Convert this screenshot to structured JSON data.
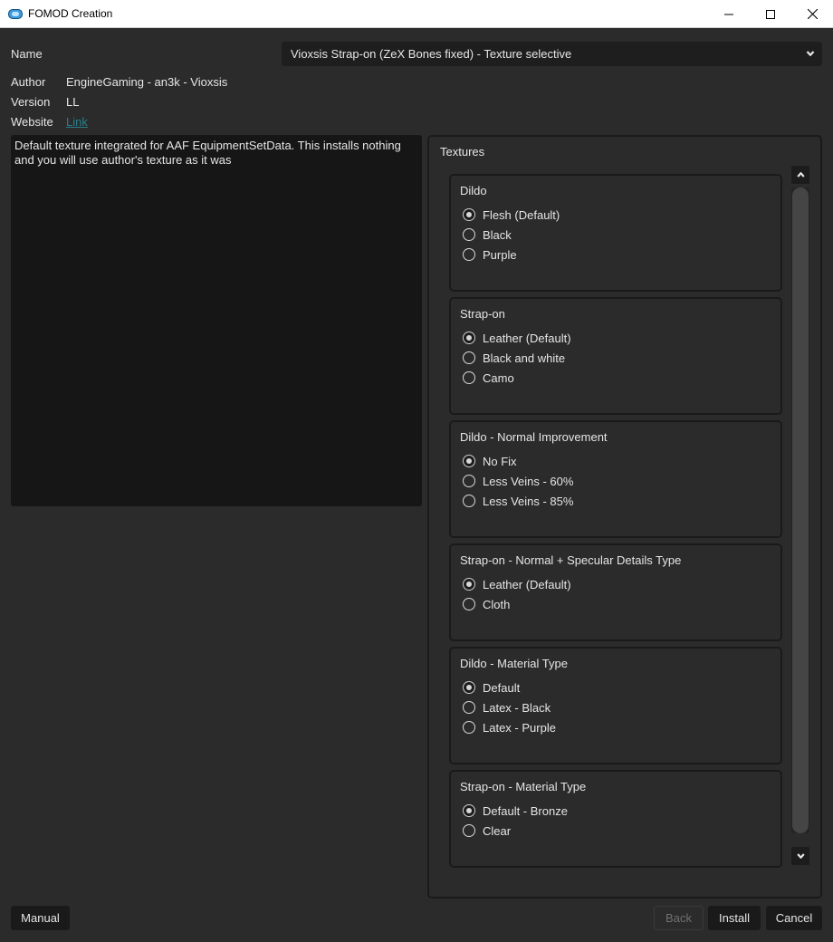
{
  "window": {
    "title": "FOMOD Creation",
    "icons": {
      "app": "fomod-app-icon",
      "minimize": "minimize-icon",
      "maximize": "maximize-icon",
      "close": "close-icon"
    }
  },
  "info": {
    "name_label": "Name",
    "name_value": "Vioxsis Strap-on (ZeX Bones fixed) - Texture selective",
    "author_label": "Author",
    "author_value": "EngineGaming - an3k - Vioxsis",
    "version_label": "Version",
    "version_value": "LL",
    "website_label": "Website",
    "website_link": "Link"
  },
  "description": "Default texture integrated for AAF EquipmentSetData. This installs nothing and you will use author's texture as it was",
  "textures": {
    "title": "Textures",
    "groups": [
      {
        "title": "Dildo",
        "options": [
          "Flesh (Default)",
          "Black",
          "Purple"
        ],
        "selected": 0
      },
      {
        "title": "Strap-on",
        "options": [
          "Leather (Default)",
          "Black and white",
          "Camo"
        ],
        "selected": 0
      },
      {
        "title": "Dildo - Normal Improvement",
        "options": [
          "No Fix",
          "Less Veins - 60%",
          "Less Veins - 85%"
        ],
        "selected": 0
      },
      {
        "title": "Strap-on - Normal + Specular Details Type",
        "options": [
          "Leather (Default)",
          "Cloth"
        ],
        "selected": 0
      },
      {
        "title": "Dildo - Material Type",
        "options": [
          "Default",
          "Latex - Black",
          "Latex - Purple"
        ],
        "selected": 0
      },
      {
        "title": "Strap-on - Material Type",
        "options": [
          "Default - Bronze",
          "Clear"
        ],
        "selected": 0
      }
    ]
  },
  "buttons": {
    "manual": "Manual",
    "back": "Back",
    "install": "Install",
    "cancel": "Cancel"
  },
  "colors": {
    "background": "#2b2b2b",
    "field": "#1e1e1e",
    "link": "#2a7f8d"
  }
}
